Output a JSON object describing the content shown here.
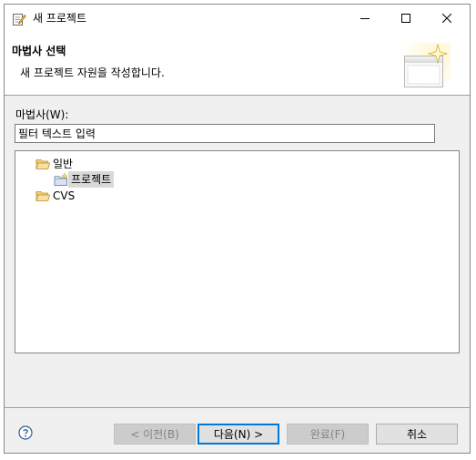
{
  "window": {
    "title": "새 프로젝트"
  },
  "banner": {
    "title": "마법사 선택",
    "description": "새 프로젝트 자원을 작성합니다."
  },
  "wizards": {
    "label": "마법사(W):",
    "filter_placeholder": "필터 텍스트 입력",
    "filter_value": "",
    "tree": [
      {
        "label": "일반",
        "icon": "folder-open-icon",
        "expanded": true,
        "level": 0
      },
      {
        "label": "프로젝트",
        "icon": "new-project-icon",
        "selected": true,
        "level": 1
      },
      {
        "label": "CVS",
        "icon": "folder-open-icon",
        "expanded": false,
        "level": 0
      }
    ]
  },
  "buttons": {
    "back": "< 이전(B)",
    "next": "다음(N) >",
    "finish": "완료(F)",
    "cancel": "취소"
  },
  "colors": {
    "accent": "#0078d7",
    "folder": "#e8b64a",
    "selection": "#d9d9d9"
  }
}
